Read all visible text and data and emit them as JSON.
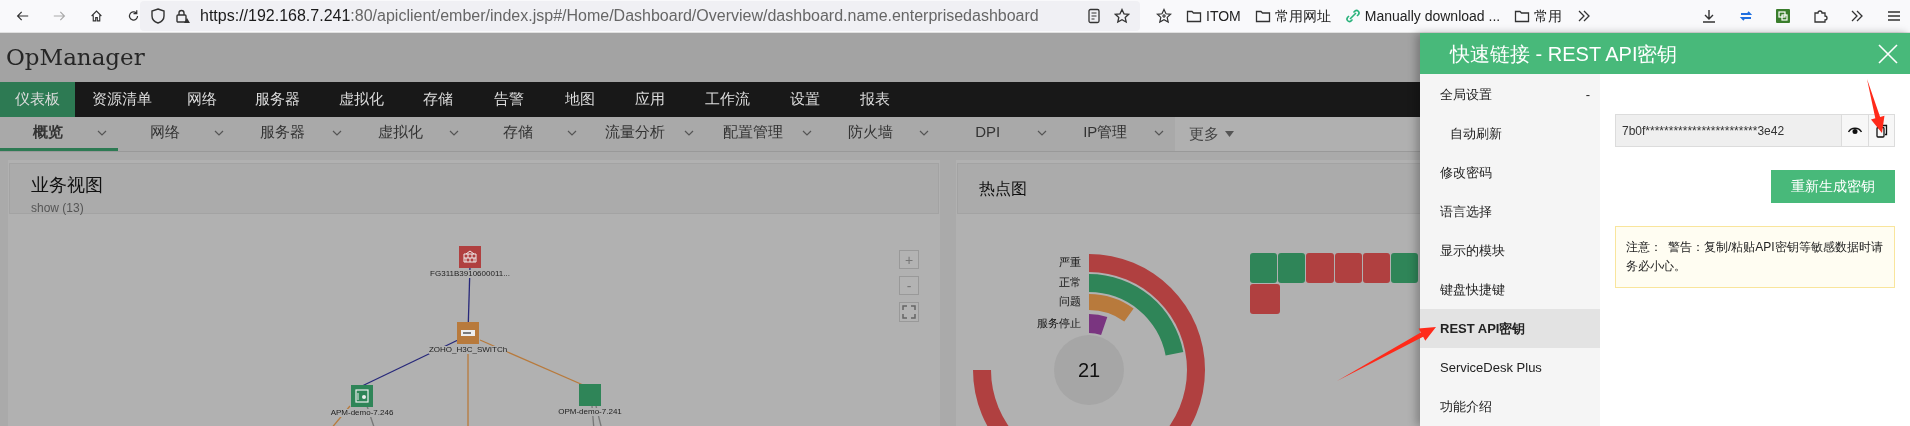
{
  "browser": {
    "url_host": "https://192.168.7.241",
    "url_rest": ":80/apiclient/ember/index.jsp#/Home/Dashboard/Overview/dashboard.name.enterprisedashboard",
    "bookmarks": [
      {
        "kind": "folder",
        "label": "ITOM"
      },
      {
        "kind": "folder",
        "label": "常用网址"
      },
      {
        "kind": "link",
        "label": "Manually download ..."
      },
      {
        "kind": "folder",
        "label": "常用"
      }
    ]
  },
  "app": {
    "title": "OpManager"
  },
  "top_nav": [
    {
      "label": "仪表板",
      "selected": true
    },
    {
      "label": "资源清单",
      "selected": false
    },
    {
      "label": "网络",
      "selected": false
    },
    {
      "label": "服务器",
      "selected": false
    },
    {
      "label": "虚拟化",
      "selected": false
    },
    {
      "label": "存储",
      "selected": false
    },
    {
      "label": "告警",
      "selected": false
    },
    {
      "label": "地图",
      "selected": false
    },
    {
      "label": "应用",
      "selected": false
    },
    {
      "label": "工作流",
      "selected": false
    },
    {
      "label": "设置",
      "selected": false
    },
    {
      "label": "报表",
      "selected": false
    }
  ],
  "sub_nav": [
    {
      "label": "概览",
      "selected": true
    },
    {
      "label": "网络",
      "selected": false
    },
    {
      "label": "服务器",
      "selected": false
    },
    {
      "label": "虚拟化",
      "selected": false
    },
    {
      "label": "存储",
      "selected": false
    },
    {
      "label": "流量分析",
      "selected": false
    },
    {
      "label": "配置管理",
      "selected": false
    },
    {
      "label": "防火墙",
      "selected": false
    },
    {
      "label": "DPI",
      "selected": false
    },
    {
      "label": "IP管理",
      "selected": false
    }
  ],
  "sub_nav_more": "更多",
  "business_view": {
    "title": "业务视图",
    "subtitle": "show (13)",
    "zoom_in": "+",
    "zoom_out": "-",
    "nodes": [
      {
        "kind": "firewall",
        "label": "FG311B3910600011...",
        "color": "#b04040"
      },
      {
        "kind": "switch",
        "label": "ZOHO_H3C_SWITCh",
        "color": "#b87a3c"
      },
      {
        "kind": "server",
        "label": "APM-demo-7.246",
        "color": "#2f8558"
      },
      {
        "kind": "plain",
        "label": "OPM-demo-7.241",
        "color": "#2f8558"
      }
    ]
  },
  "heat_map": {
    "title": "热点图",
    "center_value": "21",
    "statuses": [
      {
        "label": "严重",
        "color": "#b04040"
      },
      {
        "label": "正常",
        "color": "#2f8558"
      },
      {
        "label": "问题",
        "color": "#b87a3c"
      },
      {
        "label": "服务停止",
        "color": "#7a3580"
      }
    ],
    "tile_rows": [
      [
        {
          "color": "#2f8558"
        },
        {
          "color": "#2f8558"
        },
        {
          "color": "#b04040"
        },
        {
          "color": "#b04040"
        },
        {
          "color": "#b04040"
        },
        {
          "color": "#2f8558"
        }
      ],
      [
        {
          "color": "#b04040"
        }
      ]
    ]
  },
  "quick_links": {
    "title": "快速链接 - REST API密钥",
    "menu": [
      {
        "label": "全局设置",
        "selected": false,
        "expanded": true,
        "toggle": "-",
        "children": [
          {
            "label": "自动刷新",
            "selected": false
          }
        ]
      },
      {
        "label": "修改密码",
        "selected": false
      },
      {
        "label": "语言选择",
        "selected": false
      },
      {
        "label": "显示的模块",
        "selected": false
      },
      {
        "label": "键盘快捷键",
        "selected": false
      },
      {
        "label": "REST API密钥",
        "selected": true
      },
      {
        "label": "ServiceDesk Plus",
        "selected": false
      },
      {
        "label": "功能介绍",
        "selected": false
      }
    ],
    "api_key": "7b0f************************3e42",
    "regenerate_button": "重新生成密钥",
    "note_label": "注意：",
    "note_text": "警告：复制/粘贴API密钥等敏感数据时请务必小心。"
  }
}
